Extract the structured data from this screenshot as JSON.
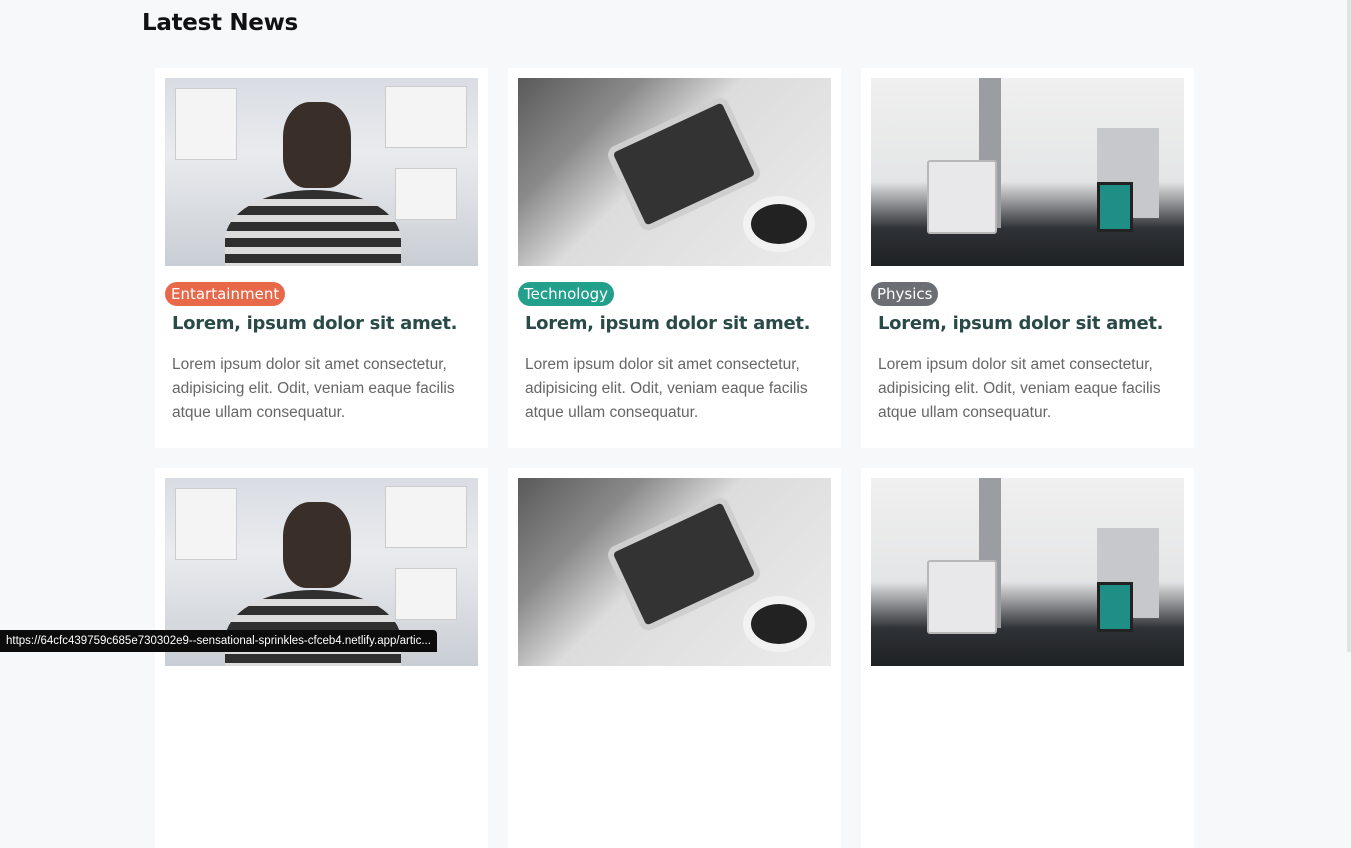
{
  "section_title": "Latest News",
  "articles": [
    {
      "tag": "Entartainment",
      "tag_color": "#e8684a",
      "image": "man-looking-at-wall-of-sketches",
      "title": "Lorem, ipsum dolor sit amet.",
      "excerpt": "Lorem ipsum dolor sit amet consectetur, adipisicing elit. Odit, veniam eaque facilis atque ullam consequatur."
    },
    {
      "tag": "Technology",
      "tag_color": "#22a08c",
      "image": "man-using-tablet-with-coffee",
      "title": "Lorem, ipsum dolor sit amet.",
      "excerpt": "Lorem ipsum dolor sit amet consectetur, adipisicing elit. Odit, veniam eaque facilis atque ullam consequatur."
    },
    {
      "tag": "Physics",
      "tag_color": "#6b6e73",
      "image": "office-desk-with-computer",
      "title": "Lorem, ipsum dolor sit amet.",
      "excerpt": "Lorem ipsum dolor sit amet consectetur, adipisicing elit. Odit, veniam eaque facilis atque ullam consequatur."
    },
    {
      "image": "man-looking-at-wall-of-sketches"
    },
    {
      "image": "man-using-tablet-with-coffee"
    },
    {
      "image": "office-desk-with-computer"
    }
  ],
  "status_bar_url": "https://64cfc439759c685e730302e9--sensational-sprinkles-cfceb4.netlify.app/artic..."
}
